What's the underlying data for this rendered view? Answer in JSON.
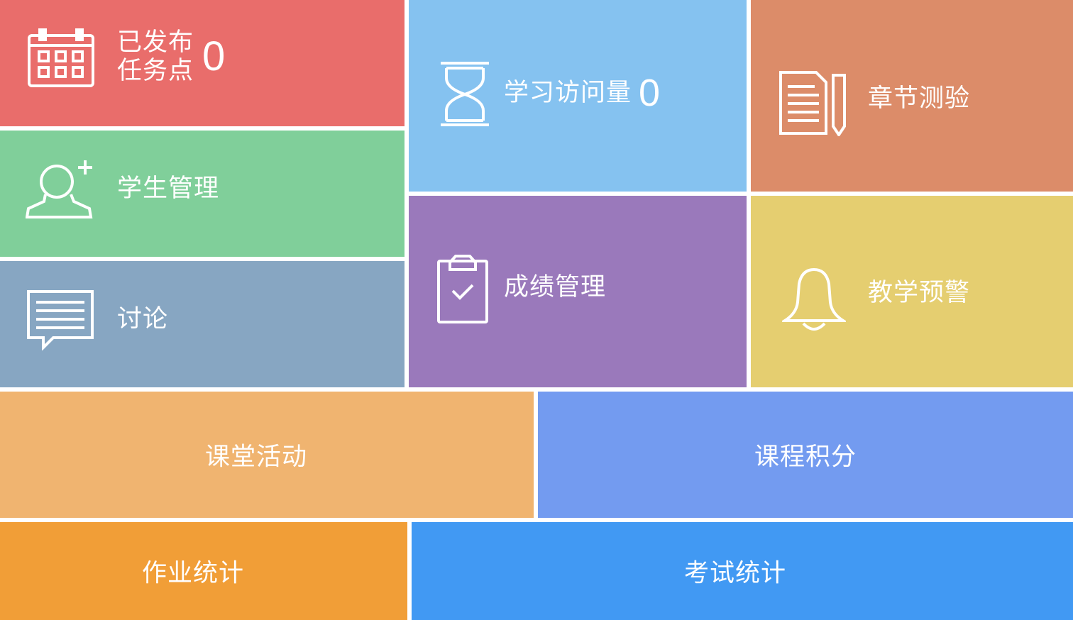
{
  "tiles": {
    "published": {
      "label_line1": "已发布",
      "label_line2": "任务点",
      "count": "0",
      "color": "#E96D6B",
      "icon": "calendar-icon"
    },
    "visits": {
      "label": "学习访问量",
      "count": "0",
      "color": "#85C2F0",
      "icon": "hourglass-icon"
    },
    "quiz": {
      "label": "章节测验",
      "color": "#DC8C69",
      "icon": "document-pen-icon"
    },
    "students": {
      "label": "学生管理",
      "color": "#80CF9A",
      "icon": "user-add-icon"
    },
    "grades": {
      "label": "成绩管理",
      "color": "#9A79BB",
      "icon": "clipboard-check-icon"
    },
    "discussion": {
      "label": "讨论",
      "color": "#87A6C2",
      "icon": "chat-icon"
    },
    "alert": {
      "label": "教学预警",
      "color": "#E5CE70",
      "icon": "bell-icon"
    },
    "class_activity": {
      "label": "课堂活动",
      "color": "#F0B470"
    },
    "course_points": {
      "label": "课程积分",
      "color": "#739BF0"
    },
    "homework_stats": {
      "label": "作业统计",
      "color": "#F19E37"
    },
    "exam_stats": {
      "label": "考试统计",
      "color": "#4199F3"
    }
  }
}
